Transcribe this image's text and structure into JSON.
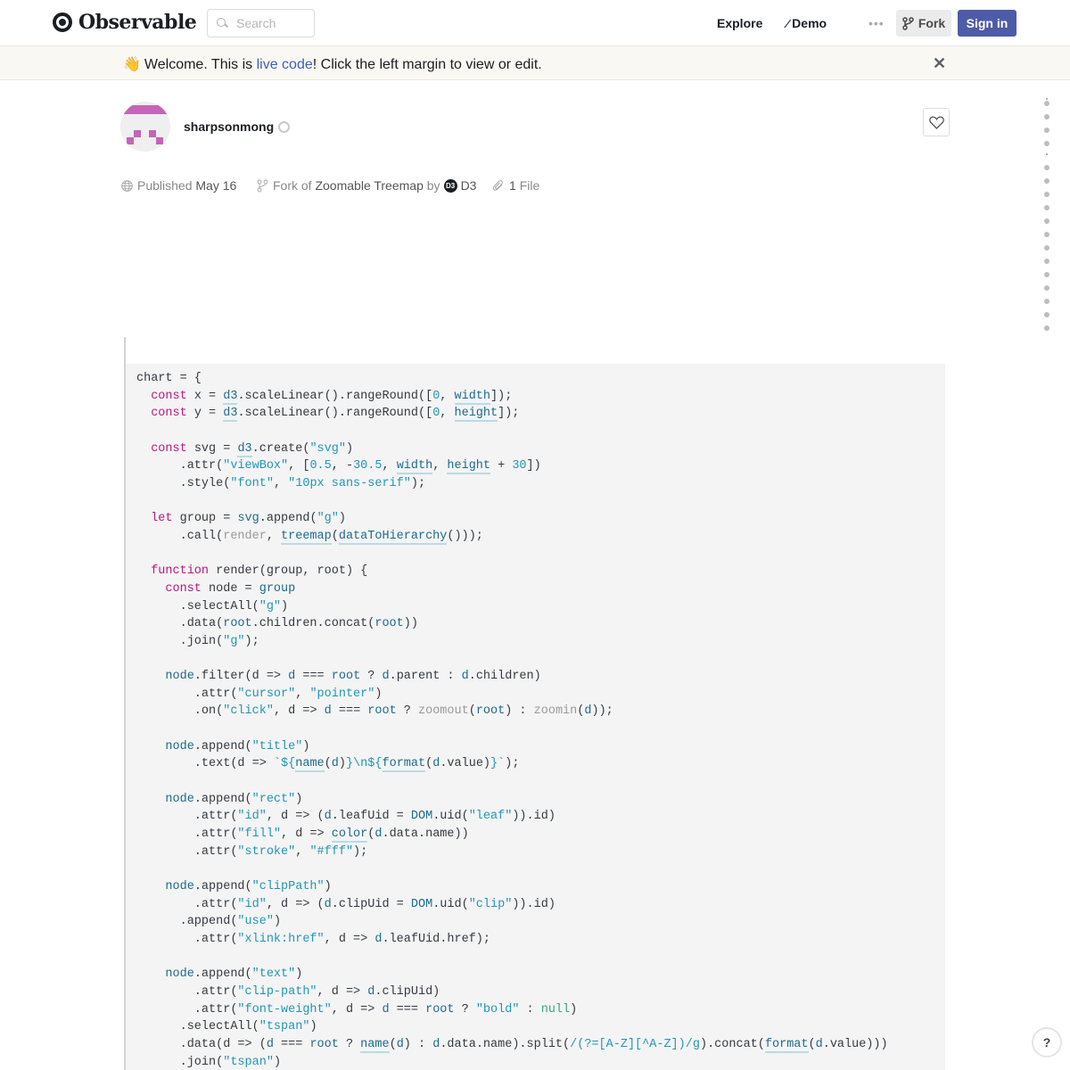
{
  "header": {
    "logo_text": "Observable",
    "search_placeholder": "Search",
    "nav": {
      "explore": "Explore",
      "demo": "Demo"
    },
    "more_label": "•••",
    "fork_label": "Fork",
    "signin_label": "Sign in"
  },
  "banner": {
    "emoji": "👋",
    "text_before": "Welcome. This is ",
    "link_text": "live code",
    "text_after": "! Click the left margin to view or edit.",
    "close_label": "✕"
  },
  "author": {
    "name": "sharpsonmong",
    "avatar_color": "#c564b8"
  },
  "meta": {
    "published_label": "Published",
    "published_date": "May 16",
    "fork_of_label": "Fork of",
    "fork_of_title": "Zoomable Treemap",
    "by_label": "by",
    "fork_author_badge": "D3",
    "fork_author": "D3",
    "files_count": "1",
    "files_label": "File"
  },
  "help_label": "?",
  "code_lines": [
    [
      [
        "",
        "chart = {"
      ]
    ],
    [
      [
        "",
        "  "
      ],
      [
        "k",
        "const"
      ],
      [
        "",
        " x = "
      ],
      [
        "u",
        "d3"
      ],
      [
        "",
        ".scaleLinear().rangeRound(["
      ],
      [
        "n",
        "0"
      ],
      [
        "",
        ", "
      ],
      [
        "u",
        "width"
      ],
      [
        "",
        "]);"
      ]
    ],
    [
      [
        "",
        "  "
      ],
      [
        "k",
        "const"
      ],
      [
        "",
        " y = "
      ],
      [
        "u",
        "d3"
      ],
      [
        "",
        ".scaleLinear().rangeRound(["
      ],
      [
        "n",
        "0"
      ],
      [
        "",
        ", "
      ],
      [
        "u",
        "height"
      ],
      [
        "",
        "]);"
      ]
    ],
    [
      [
        "",
        ""
      ]
    ],
    [
      [
        "",
        "  "
      ],
      [
        "k",
        "const"
      ],
      [
        "",
        " svg = "
      ],
      [
        "u",
        "d3"
      ],
      [
        "",
        ".create("
      ],
      [
        "s",
        "\"svg\""
      ],
      [
        "",
        ")"
      ]
    ],
    [
      [
        "",
        "      .attr("
      ],
      [
        "s",
        "\"viewBox\""
      ],
      [
        "",
        ", ["
      ],
      [
        "n",
        "0.5"
      ],
      [
        "",
        ", -"
      ],
      [
        "n",
        "30.5"
      ],
      [
        "",
        ", "
      ],
      [
        "u",
        "width"
      ],
      [
        "",
        ", "
      ],
      [
        "u",
        "height"
      ],
      [
        "",
        " + "
      ],
      [
        "n",
        "30"
      ],
      [
        "",
        "])"
      ]
    ],
    [
      [
        "",
        "      .style("
      ],
      [
        "s",
        "\"font\""
      ],
      [
        "",
        ", "
      ],
      [
        "s",
        "\"10px sans-serif\""
      ],
      [
        "",
        ");"
      ]
    ],
    [
      [
        "",
        ""
      ]
    ],
    [
      [
        "",
        "  "
      ],
      [
        "k",
        "let"
      ],
      [
        "",
        " group = "
      ],
      [
        "v",
        "svg"
      ],
      [
        "",
        ".append("
      ],
      [
        "s",
        "\"g\""
      ],
      [
        "",
        ")"
      ]
    ],
    [
      [
        "",
        "      .call("
      ],
      [
        "g",
        "render"
      ],
      [
        "",
        ", "
      ],
      [
        "u",
        "treemap"
      ],
      [
        "",
        "("
      ],
      [
        "u",
        "dataToHierarchy"
      ],
      [
        "",
        "()));"
      ]
    ],
    [
      [
        "",
        ""
      ]
    ],
    [
      [
        "",
        "  "
      ],
      [
        "k",
        "function"
      ],
      [
        "",
        " render(group, root) {"
      ]
    ],
    [
      [
        "",
        "    "
      ],
      [
        "k",
        "const"
      ],
      [
        "",
        " node = "
      ],
      [
        "v",
        "group"
      ]
    ],
    [
      [
        "",
        "      .selectAll("
      ],
      [
        "s",
        "\"g\""
      ],
      [
        "",
        ")"
      ]
    ],
    [
      [
        "",
        "      .data("
      ],
      [
        "v",
        "root"
      ],
      [
        "",
        ".children.concat("
      ],
      [
        "v",
        "root"
      ],
      [
        "",
        "))"
      ]
    ],
    [
      [
        "",
        "      .join("
      ],
      [
        "s",
        "\"g\""
      ],
      [
        "",
        ");"
      ]
    ],
    [
      [
        "",
        ""
      ]
    ],
    [
      [
        "",
        "    "
      ],
      [
        "v",
        "node"
      ],
      [
        "",
        ".filter(d => "
      ],
      [
        "v",
        "d"
      ],
      [
        "",
        " === "
      ],
      [
        "v",
        "root"
      ],
      [
        "",
        " ? "
      ],
      [
        "v",
        "d"
      ],
      [
        "",
        ".parent : "
      ],
      [
        "v",
        "d"
      ],
      [
        "",
        ".children)"
      ]
    ],
    [
      [
        "",
        "        .attr("
      ],
      [
        "s",
        "\"cursor\""
      ],
      [
        "",
        ", "
      ],
      [
        "s",
        "\"pointer\""
      ],
      [
        "",
        ")"
      ]
    ],
    [
      [
        "",
        "        .on("
      ],
      [
        "s",
        "\"click\""
      ],
      [
        "",
        ", d => "
      ],
      [
        "v",
        "d"
      ],
      [
        "",
        " === "
      ],
      [
        "v",
        "root"
      ],
      [
        "",
        " ? "
      ],
      [
        "g",
        "zoomout"
      ],
      [
        "",
        "("
      ],
      [
        "v",
        "root"
      ],
      [
        "",
        ") : "
      ],
      [
        "g",
        "zoomin"
      ],
      [
        "",
        "("
      ],
      [
        "v",
        "d"
      ],
      [
        "",
        "));"
      ]
    ],
    [
      [
        "",
        ""
      ]
    ],
    [
      [
        "",
        "    "
      ],
      [
        "v",
        "node"
      ],
      [
        "",
        ".append("
      ],
      [
        "s",
        "\"title\""
      ],
      [
        "",
        ")"
      ]
    ],
    [
      [
        "",
        "        .text(d => "
      ],
      [
        "s",
        "`${"
      ],
      [
        "u",
        "name"
      ],
      [
        "",
        "("
      ],
      [
        "v",
        "d"
      ],
      [
        "",
        ")"
      ],
      [
        "s",
        "}\\n${"
      ],
      [
        "u",
        "format"
      ],
      [
        "",
        "("
      ],
      [
        "v",
        "d"
      ],
      [
        "",
        ".value)"
      ],
      [
        "s",
        "}`"
      ],
      [
        "",
        ");"
      ]
    ],
    [
      [
        "",
        ""
      ]
    ],
    [
      [
        "",
        "    "
      ],
      [
        "v",
        "node"
      ],
      [
        "",
        ".append("
      ],
      [
        "s",
        "\"rect\""
      ],
      [
        "",
        ")"
      ]
    ],
    [
      [
        "",
        "        .attr("
      ],
      [
        "s",
        "\"id\""
      ],
      [
        "",
        ", d => ("
      ],
      [
        "v",
        "d"
      ],
      [
        "",
        ".leafUid = "
      ],
      [
        "v",
        "DOM"
      ],
      [
        "",
        ".uid("
      ],
      [
        "s",
        "\"leaf\""
      ],
      [
        "",
        "))"
      ],
      [
        "",
        ".id)"
      ]
    ],
    [
      [
        "",
        "        .attr("
      ],
      [
        "s",
        "\"fill\""
      ],
      [
        "",
        ", d => "
      ],
      [
        "u",
        "color"
      ],
      [
        "",
        "("
      ],
      [
        "v",
        "d"
      ],
      [
        "",
        ".data.name))"
      ]
    ],
    [
      [
        "",
        "        .attr("
      ],
      [
        "s",
        "\"stroke\""
      ],
      [
        "",
        ", "
      ],
      [
        "s",
        "\"#fff\""
      ],
      [
        "",
        ");"
      ]
    ],
    [
      [
        "",
        ""
      ]
    ],
    [
      [
        "",
        "    "
      ],
      [
        "v",
        "node"
      ],
      [
        "",
        ".append("
      ],
      [
        "s",
        "\"clipPath\""
      ],
      [
        "",
        ")"
      ]
    ],
    [
      [
        "",
        "        .attr("
      ],
      [
        "s",
        "\"id\""
      ],
      [
        "",
        ", d => ("
      ],
      [
        "v",
        "d"
      ],
      [
        "",
        ".clipUid = "
      ],
      [
        "v",
        "DOM"
      ],
      [
        "",
        ".uid("
      ],
      [
        "s",
        "\"clip\""
      ],
      [
        "",
        "))"
      ],
      [
        "",
        ".id)"
      ]
    ],
    [
      [
        "",
        "      .append("
      ],
      [
        "s",
        "\"use\""
      ],
      [
        "",
        ")"
      ]
    ],
    [
      [
        "",
        "        .attr("
      ],
      [
        "s",
        "\"xlink:href\""
      ],
      [
        "",
        ", d => "
      ],
      [
        "v",
        "d"
      ],
      [
        "",
        ".leafUid.href);"
      ]
    ],
    [
      [
        "",
        ""
      ]
    ],
    [
      [
        "",
        "    "
      ],
      [
        "v",
        "node"
      ],
      [
        "",
        ".append("
      ],
      [
        "s",
        "\"text\""
      ],
      [
        "",
        ")"
      ]
    ],
    [
      [
        "",
        "        .attr("
      ],
      [
        "s",
        "\"clip-path\""
      ],
      [
        "",
        ", d => "
      ],
      [
        "v",
        "d"
      ],
      [
        "",
        ".clipUid)"
      ]
    ],
    [
      [
        "",
        "        .attr("
      ],
      [
        "s",
        "\"font-weight\""
      ],
      [
        "",
        ", d => "
      ],
      [
        "v",
        "d"
      ],
      [
        "",
        " === "
      ],
      [
        "v",
        "root"
      ],
      [
        "",
        " ? "
      ],
      [
        "s",
        "\"bold\""
      ],
      [
        "",
        " : "
      ],
      [
        "l",
        "null"
      ],
      [
        "",
        ")"
      ]
    ],
    [
      [
        "",
        "      .selectAll("
      ],
      [
        "s",
        "\"tspan\""
      ],
      [
        "",
        ")"
      ]
    ],
    [
      [
        "",
        "      .data(d => ("
      ],
      [
        "v",
        "d"
      ],
      [
        "",
        " === "
      ],
      [
        "v",
        "root"
      ],
      [
        "",
        " ? "
      ],
      [
        "u",
        "name"
      ],
      [
        "",
        "("
      ],
      [
        "v",
        "d"
      ],
      [
        "",
        ") : "
      ],
      [
        "v",
        "d"
      ],
      [
        "",
        ".data.name).split("
      ],
      [
        "s",
        "/(?=[A-Z][^A-Z])/g"
      ],
      [
        "",
        ").concat("
      ],
      [
        "u",
        "format"
      ],
      [
        "",
        "("
      ],
      [
        "v",
        "d"
      ],
      [
        "",
        ".value)))"
      ]
    ],
    [
      [
        "",
        "      .join("
      ],
      [
        "s",
        "\"tspan\""
      ],
      [
        "",
        ")"
      ]
    ]
  ]
}
